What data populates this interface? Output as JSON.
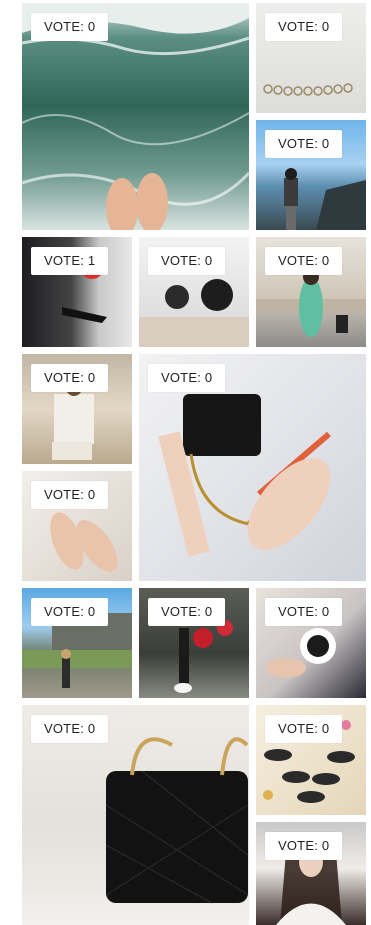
{
  "tiles": [
    {
      "vote_label": "VOTE: 0",
      "photo": "ocean-feet"
    },
    {
      "vote_label": "VOTE: 0",
      "photo": "bracelet"
    },
    {
      "vote_label": "VOTE: 0",
      "photo": "coast"
    },
    {
      "vote_label": "VOTE: 1",
      "photo": "street"
    },
    {
      "vote_label": "VOTE: 0",
      "photo": "watches"
    },
    {
      "vote_label": "VOTE: 0",
      "photo": "bench"
    },
    {
      "vote_label": "VOTE: 0",
      "photo": "beach"
    },
    {
      "vote_label": "VOTE: 0",
      "photo": "bag-sandals"
    },
    {
      "vote_label": "VOTE: 0",
      "photo": "feet"
    },
    {
      "vote_label": "VOTE: 0",
      "photo": "castle"
    },
    {
      "vote_label": "VOTE: 0",
      "photo": "roses"
    },
    {
      "vote_label": "VOTE: 0",
      "photo": "coffee"
    },
    {
      "vote_label": "VOTE: 0",
      "photo": "chanel-tote"
    },
    {
      "vote_label": "VOTE: 0",
      "photo": "shoes"
    },
    {
      "vote_label": "VOTE: 0",
      "photo": "portrait"
    }
  ],
  "colors": {
    "background": "#ffffff",
    "badge_bg": "#ffffff",
    "badge_text": "#222222"
  }
}
